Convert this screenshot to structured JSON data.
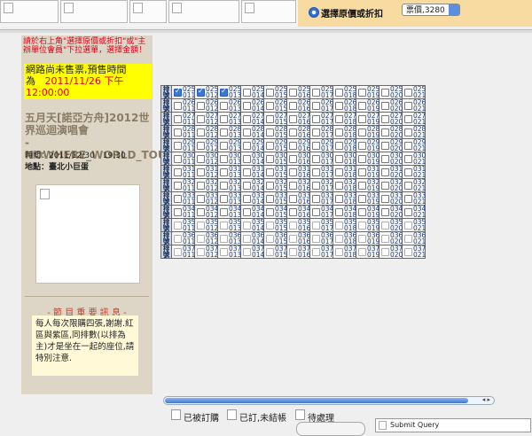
{
  "price": {
    "option_label": "選擇原價或折扣",
    "selected": "票價,3280"
  },
  "instruction": "請於右上角\"選擇原價或折扣\"或\"主辦單位會員\"下拉選單，選擇金額！",
  "notice": {
    "line1": "網路尚未售票,預售時間",
    "prefix": "為",
    "datetime": "2011/11/26 下午",
    "time": "12:00:00"
  },
  "event": {
    "title": "五月天[諾亞方舟]2012世界巡迴演唱會",
    "tour": "-NOWHERE_WORLD_TOUR",
    "time": "時間：2011/12/30　19:30",
    "place": "地點：臺北小巨蛋"
  },
  "news": {
    "title": "- 節 目 重 要 訊 息 -",
    "body": "每人每次限購四張,謝謝.紅區與紫區,同排數(以排為主)才是坐在一起的座位,請特別注意."
  },
  "seat_map": {
    "row_label": "排號",
    "rows": [
      "025",
      "026",
      "027",
      "028",
      "029",
      "030",
      "031",
      "032",
      "033",
      "034",
      "035",
      "036",
      "037"
    ],
    "seats": [
      "011",
      "012",
      "013",
      "014",
      "015",
      "016",
      "017",
      "018",
      "019",
      "020",
      "021"
    ],
    "checked": [
      [
        0,
        0
      ],
      [
        0,
        1
      ],
      [
        0,
        2
      ]
    ],
    "disabled_rows_from": 10
  },
  "legend": {
    "ordered": "已被訂購",
    "unpaid": "已訂,未結帳",
    "pending": "待處理"
  },
  "submit_label": "Submit Query"
}
